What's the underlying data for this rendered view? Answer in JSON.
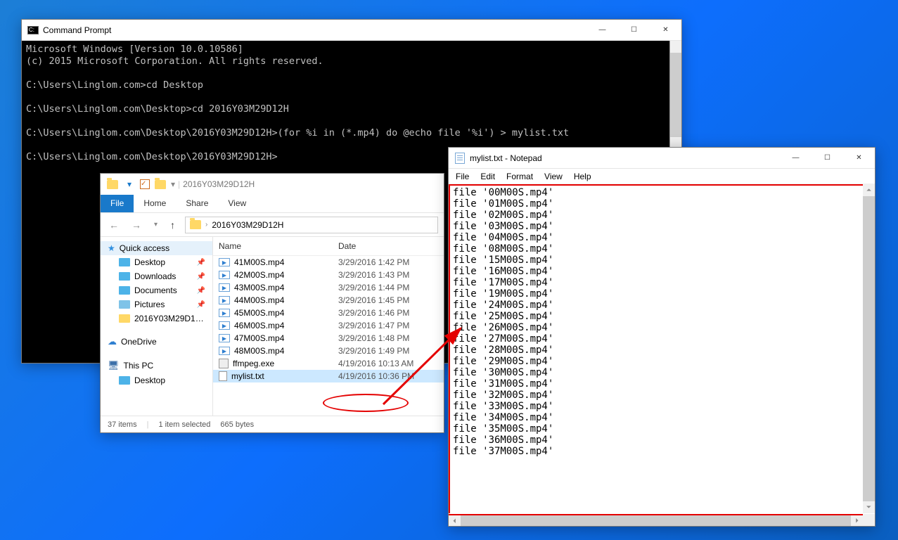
{
  "cmd": {
    "title": "Command Prompt",
    "lines": [
      "Microsoft Windows [Version 10.0.10586]",
      "(c) 2015 Microsoft Corporation. All rights reserved.",
      "",
      "C:\\Users\\Linglom.com>cd Desktop",
      "",
      "C:\\Users\\Linglom.com\\Desktop>cd 2016Y03M29D12H",
      "",
      "C:\\Users\\Linglom.com\\Desktop\\2016Y03M29D12H>(for %i in (*.mp4) do @echo file '%i') > mylist.txt",
      "",
      "C:\\Users\\Linglom.com\\Desktop\\2016Y03M29D12H>"
    ]
  },
  "explorer": {
    "title": "2016Y03M29D12H",
    "ribbon": {
      "file": "File",
      "home": "Home",
      "share": "Share",
      "view": "View"
    },
    "breadcrumb": "2016Y03M29D12H",
    "nav": {
      "quick": "Quick access",
      "desktop": "Desktop",
      "downloads": "Downloads",
      "documents": "Documents",
      "pictures": "Pictures",
      "recent": "2016Y03M29D1…",
      "onedrive": "OneDrive",
      "thispc": "This PC",
      "desktop2": "Desktop"
    },
    "columns": {
      "name": "Name",
      "date": "Date"
    },
    "files": [
      {
        "name": "41M00S.mp4",
        "date": "3/29/2016 1:42 PM",
        "type": "video"
      },
      {
        "name": "42M00S.mp4",
        "date": "3/29/2016 1:43 PM",
        "type": "video"
      },
      {
        "name": "43M00S.mp4",
        "date": "3/29/2016 1:44 PM",
        "type": "video"
      },
      {
        "name": "44M00S.mp4",
        "date": "3/29/2016 1:45 PM",
        "type": "video"
      },
      {
        "name": "45M00S.mp4",
        "date": "3/29/2016 1:46 PM",
        "type": "video"
      },
      {
        "name": "46M00S.mp4",
        "date": "3/29/2016 1:47 PM",
        "type": "video"
      },
      {
        "name": "47M00S.mp4",
        "date": "3/29/2016 1:48 PM",
        "type": "video"
      },
      {
        "name": "48M00S.mp4",
        "date": "3/29/2016 1:49 PM",
        "type": "video"
      },
      {
        "name": "ffmpeg.exe",
        "date": "4/19/2016 10:13 AM",
        "type": "exe"
      },
      {
        "name": "mylist.txt",
        "date": "4/19/2016 10:36 PM",
        "type": "txt",
        "selected": true
      }
    ],
    "status": {
      "items": "37 items",
      "sel": "1 item selected",
      "size": "665 bytes"
    }
  },
  "notepad": {
    "title": "mylist.txt - Notepad",
    "menu": {
      "file": "File",
      "edit": "Edit",
      "format": "Format",
      "view": "View",
      "help": "Help"
    },
    "lines": [
      "file '00M00S.mp4'",
      "file '01M00S.mp4'",
      "file '02M00S.mp4'",
      "file '03M00S.mp4'",
      "file '04M00S.mp4'",
      "file '08M00S.mp4'",
      "file '15M00S.mp4'",
      "file '16M00S.mp4'",
      "file '17M00S.mp4'",
      "file '19M00S.mp4'",
      "file '24M00S.mp4'",
      "file '25M00S.mp4'",
      "file '26M00S.mp4'",
      "file '27M00S.mp4'",
      "file '28M00S.mp4'",
      "file '29M00S.mp4'",
      "file '30M00S.mp4'",
      "file '31M00S.mp4'",
      "file '32M00S.mp4'",
      "file '33M00S.mp4'",
      "file '34M00S.mp4'",
      "file '35M00S.mp4'",
      "file '36M00S.mp4'",
      "file '37M00S.mp4'"
    ]
  }
}
